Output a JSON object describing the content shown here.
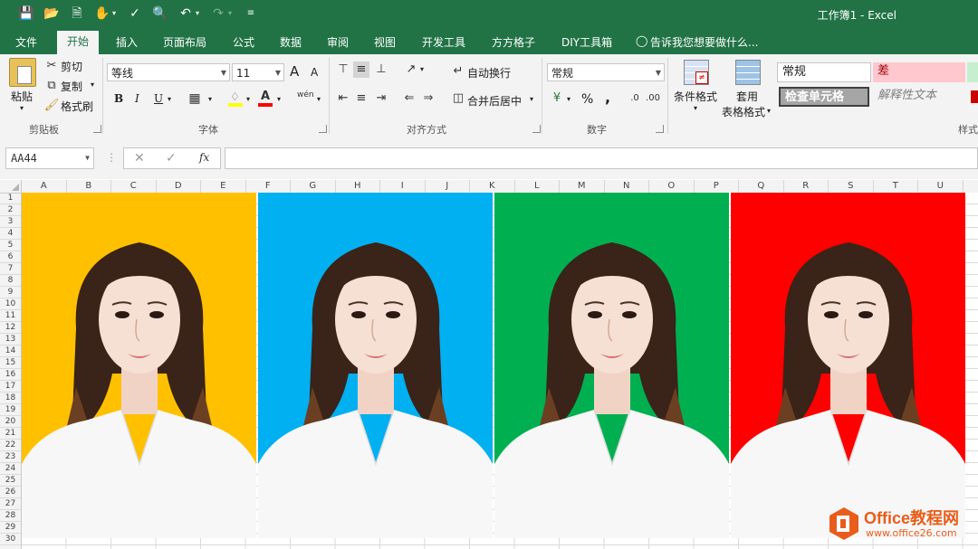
{
  "window": {
    "title": "工作簿1 - Excel"
  },
  "tabs": [
    "文件",
    "开始",
    "插入",
    "页面布局",
    "公式",
    "数据",
    "审阅",
    "视图",
    "开发工具",
    "方方格子",
    "DIY工具箱"
  ],
  "tell_me": "告诉我您想要做什么...",
  "ribbon": {
    "clipboard": {
      "paste": "粘贴",
      "cut": "剪切",
      "copy": "复制",
      "format_painter": "格式刷",
      "label": "剪贴板"
    },
    "font": {
      "name": "等线",
      "size": "11",
      "bold": "B",
      "italic": "I",
      "underline": "U",
      "grow": "A",
      "shrink": "A",
      "phonetic": "wén",
      "label": "字体"
    },
    "alignment": {
      "wrap": "自动换行",
      "merge": "合并后居中",
      "label": "对齐方式"
    },
    "number": {
      "format": "常规",
      "percent": "%",
      "comma": ",",
      "label": "数字"
    },
    "styles": {
      "conditional": "条件格式",
      "table_format_1": "套用",
      "table_format_2": "表格格式",
      "cells": [
        "常规",
        "差",
        "检查单元格",
        "解释性文本"
      ],
      "label": "样式"
    }
  },
  "formula_bar": {
    "name_box": "AA44",
    "fx": "fx"
  },
  "grid": {
    "columns": [
      "A",
      "B",
      "C",
      "D",
      "E",
      "F",
      "G",
      "H",
      "I",
      "J",
      "K",
      "L",
      "M",
      "N",
      "O",
      "P",
      "Q",
      "R",
      "S",
      "T",
      "U"
    ],
    "rows": [
      "1",
      "2",
      "3",
      "4",
      "5",
      "6",
      "7",
      "8",
      "9",
      "10",
      "11",
      "12",
      "13",
      "14",
      "15",
      "16",
      "17",
      "18",
      "19",
      "20",
      "21",
      "22",
      "23",
      "24",
      "25",
      "26",
      "27",
      "28",
      "29",
      "30"
    ],
    "photos": [
      {
        "bg": "#ffc000",
        "name": "photo-yellow-background"
      },
      {
        "bg": "#00b0f0",
        "name": "photo-blue-background"
      },
      {
        "bg": "#00b050",
        "name": "photo-green-background"
      },
      {
        "bg": "#ff0000",
        "name": "photo-red-background"
      }
    ]
  },
  "watermark": {
    "brand": "Office教程网",
    "url": "www.office26.com"
  },
  "colors": {
    "accent": "#217346",
    "orange": "#e85d1b"
  }
}
